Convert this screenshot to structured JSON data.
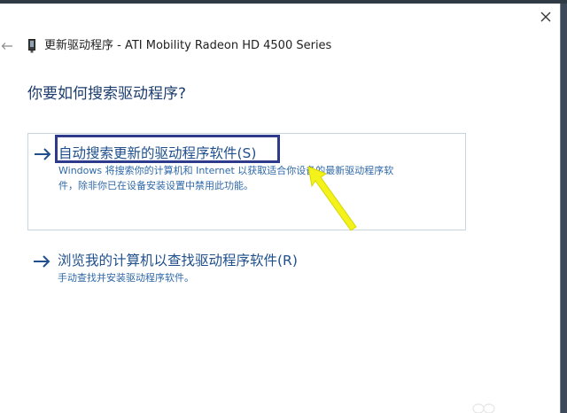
{
  "window": {
    "header_title": "更新驱动程序 - ATI Mobility Radeon HD 4500 Series",
    "close_glyph": "✕",
    "back_glyph": "←"
  },
  "main": {
    "page_title": "你要如何搜索驱动程序?",
    "options": [
      {
        "title": "自动搜索更新的驱动程序软件(S)",
        "desc_line1": "Windows 将搜索你的计算机和 Internet 以获取适合你设备的最新驱动程序软",
        "desc_line2": "件，除非你已在设备安装设置中禁用此功能。"
      },
      {
        "title": "浏览我的计算机以查找驱动程序软件(R)",
        "desc_line1": "手动查找并安装驱动程序软件。"
      }
    ]
  },
  "colors": {
    "accent_blue": "#1f4f8c",
    "link_blue": "#2f69a8",
    "highlight_border": "#2e3a8c",
    "annotation_yellow": "#f3f21a"
  },
  "icons": {
    "back": "back-arrow-icon",
    "device": "device-icon",
    "close": "close-icon",
    "option_arrow": "right-arrow-icon"
  }
}
